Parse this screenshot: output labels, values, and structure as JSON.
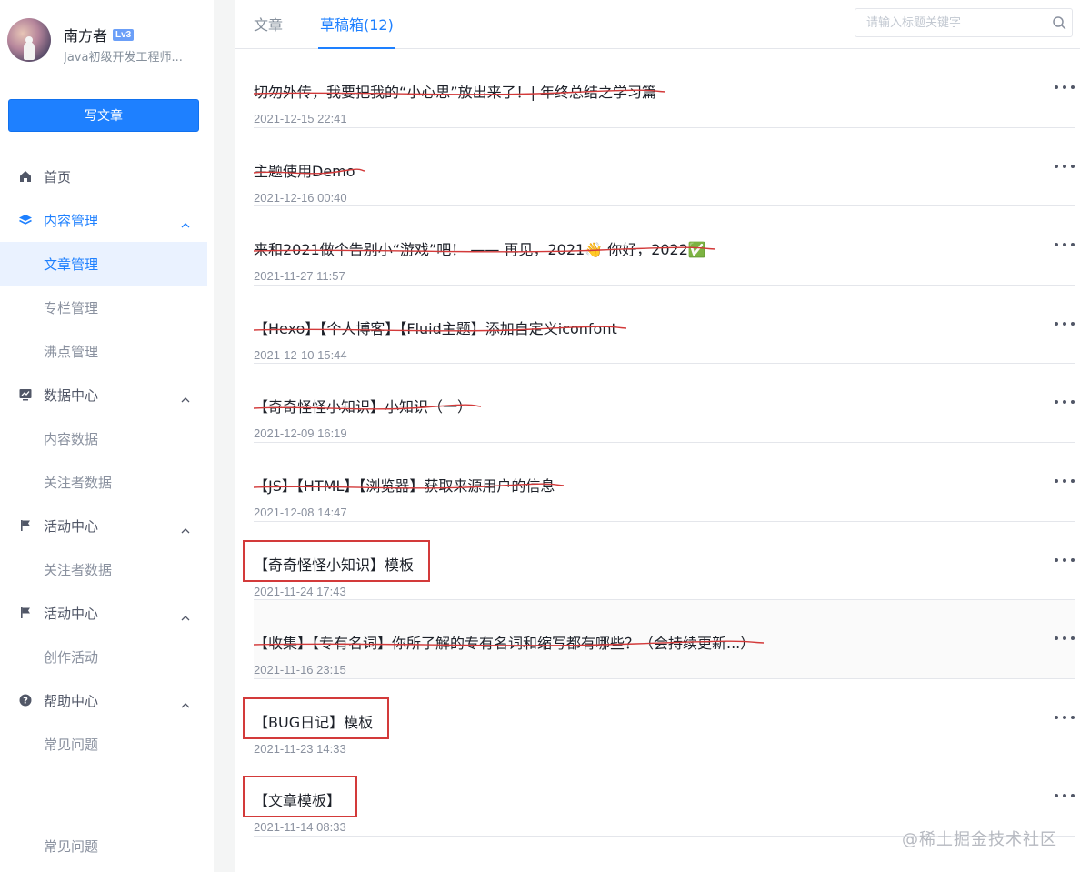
{
  "user": {
    "name": "南方者",
    "level": "Lv3",
    "title": "Java初级开发工程师..."
  },
  "sidebar": {
    "write_button": "写文章",
    "items": [
      {
        "label": "首页",
        "type": "parent",
        "icon": "home-icon"
      },
      {
        "label": "内容管理",
        "type": "parent",
        "icon": "layers-icon",
        "expanded": true
      },
      {
        "label": "文章管理",
        "type": "child",
        "active": true
      },
      {
        "label": "专栏管理",
        "type": "child"
      },
      {
        "label": "沸点管理",
        "type": "child"
      },
      {
        "label": "数据中心",
        "type": "parent",
        "icon": "chart-icon",
        "expanded": true
      },
      {
        "label": "内容数据",
        "type": "child"
      },
      {
        "label": "关注者数据",
        "type": "child"
      },
      {
        "label": "活动中心",
        "type": "parent",
        "icon": "flag-icon",
        "expanded": true
      },
      {
        "label": "关注者数据",
        "type": "child"
      },
      {
        "label": "活动中心",
        "type": "parent",
        "icon": "flag-icon",
        "expanded": true
      },
      {
        "label": "创作活动",
        "type": "child"
      },
      {
        "label": "帮助中心",
        "type": "parent",
        "icon": "help-icon",
        "expanded": true
      },
      {
        "label": "常见问题",
        "type": "child"
      },
      {
        "label": "常见问题",
        "type": "child"
      }
    ]
  },
  "tabs": [
    {
      "label": "文章"
    },
    {
      "label": "草稿箱(12)",
      "active": true
    }
  ],
  "search": {
    "placeholder": "请输入标题关键字"
  },
  "drafts": [
    {
      "title": "切勿外传，我要把我的“小心思”放出来了！| 年终总结之学习篇",
      "time": "2021-12-15 22:41",
      "struck": true
    },
    {
      "title": "主题使用Demo",
      "time": "2021-12-16 00:40",
      "struck": true
    },
    {
      "title": "来和2021做个告别小“游戏”吧！ —— 再见，2021👋 你好，2022✅",
      "time": "2021-11-27 11:57",
      "struck": true
    },
    {
      "title": "【Hexo】【个人博客】【Fluid主题】添加自定义iconfont",
      "time": "2021-12-10 15:44",
      "struck": true
    },
    {
      "title": "【奇奇怪怪小知识】小知识（一）",
      "time": "2021-12-09 16:19",
      "struck": true
    },
    {
      "title": "【JS】【HTML】【浏览器】获取来源用户的信息",
      "time": "2021-12-08 14:47",
      "struck": true
    },
    {
      "title": "【奇奇怪怪小知识】模板",
      "time": "2021-11-24 17:43",
      "boxed": true
    },
    {
      "title": "【收集】【专有名词】你所了解的专有名词和缩写都有哪些？（会持续更新...）",
      "time": "2021-11-16 23:15",
      "struck": true
    },
    {
      "title": "【BUG日记】模板",
      "time": "2021-11-23 14:33",
      "boxed": true
    },
    {
      "title": "【文章模板】",
      "time": "2021-11-14 08:33",
      "boxed": true
    }
  ],
  "watermark": "@稀土掘金技术社区",
  "colors": {
    "accent": "#1e80ff",
    "annotation_red": "#d33a3a"
  }
}
